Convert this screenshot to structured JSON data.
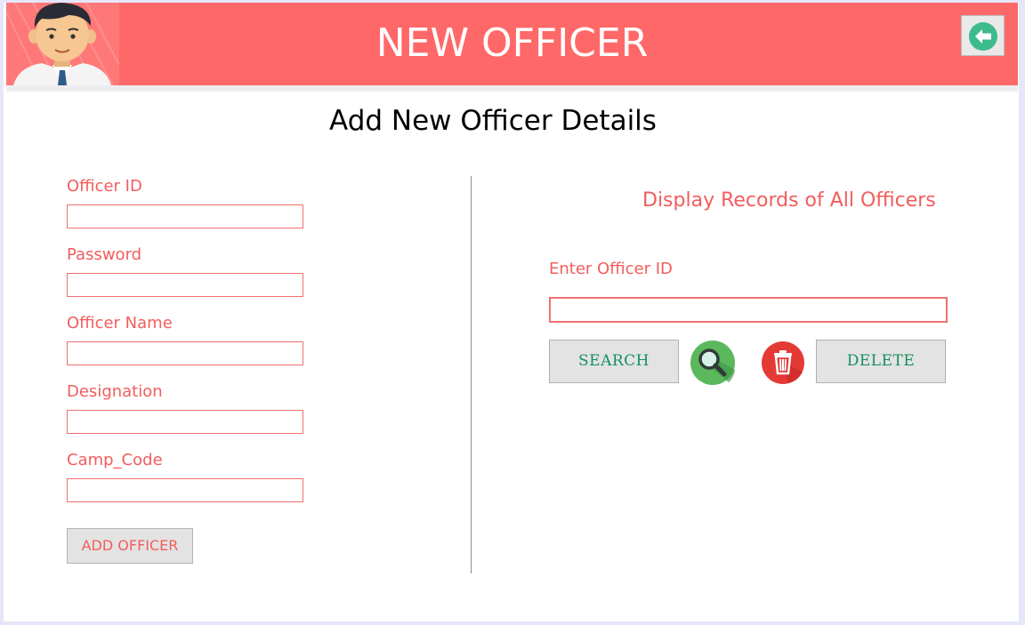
{
  "header": {
    "title": "NEW OFFICER",
    "back_icon": "arrow-left-circle-icon",
    "avatar_icon": "officer-avatar-icon",
    "background_color": "#ff6868"
  },
  "page": {
    "subtitle": "Add New Officer Details"
  },
  "form": {
    "fields": [
      {
        "label": "Officer ID",
        "value": ""
      },
      {
        "label": "Password",
        "value": ""
      },
      {
        "label": "Officer Name",
        "value": ""
      },
      {
        "label": "Designation",
        "value": ""
      },
      {
        "label": "Camp_Code",
        "value": ""
      }
    ],
    "add_button": "ADD OFFICER"
  },
  "records": {
    "title": "Display Records of All Officers",
    "enter_label": "Enter Officer ID",
    "search_value": "",
    "search_button": "SEARCH",
    "delete_button": "DELETE",
    "search_icon": "magnifier-icon",
    "delete_icon": "trash-icon"
  },
  "colors": {
    "accent": "#f25d5d",
    "button_text": "#13905f",
    "search_icon": "#5cb85c",
    "delete_icon": "#e53935",
    "back_icon": "#3dbb8e"
  }
}
